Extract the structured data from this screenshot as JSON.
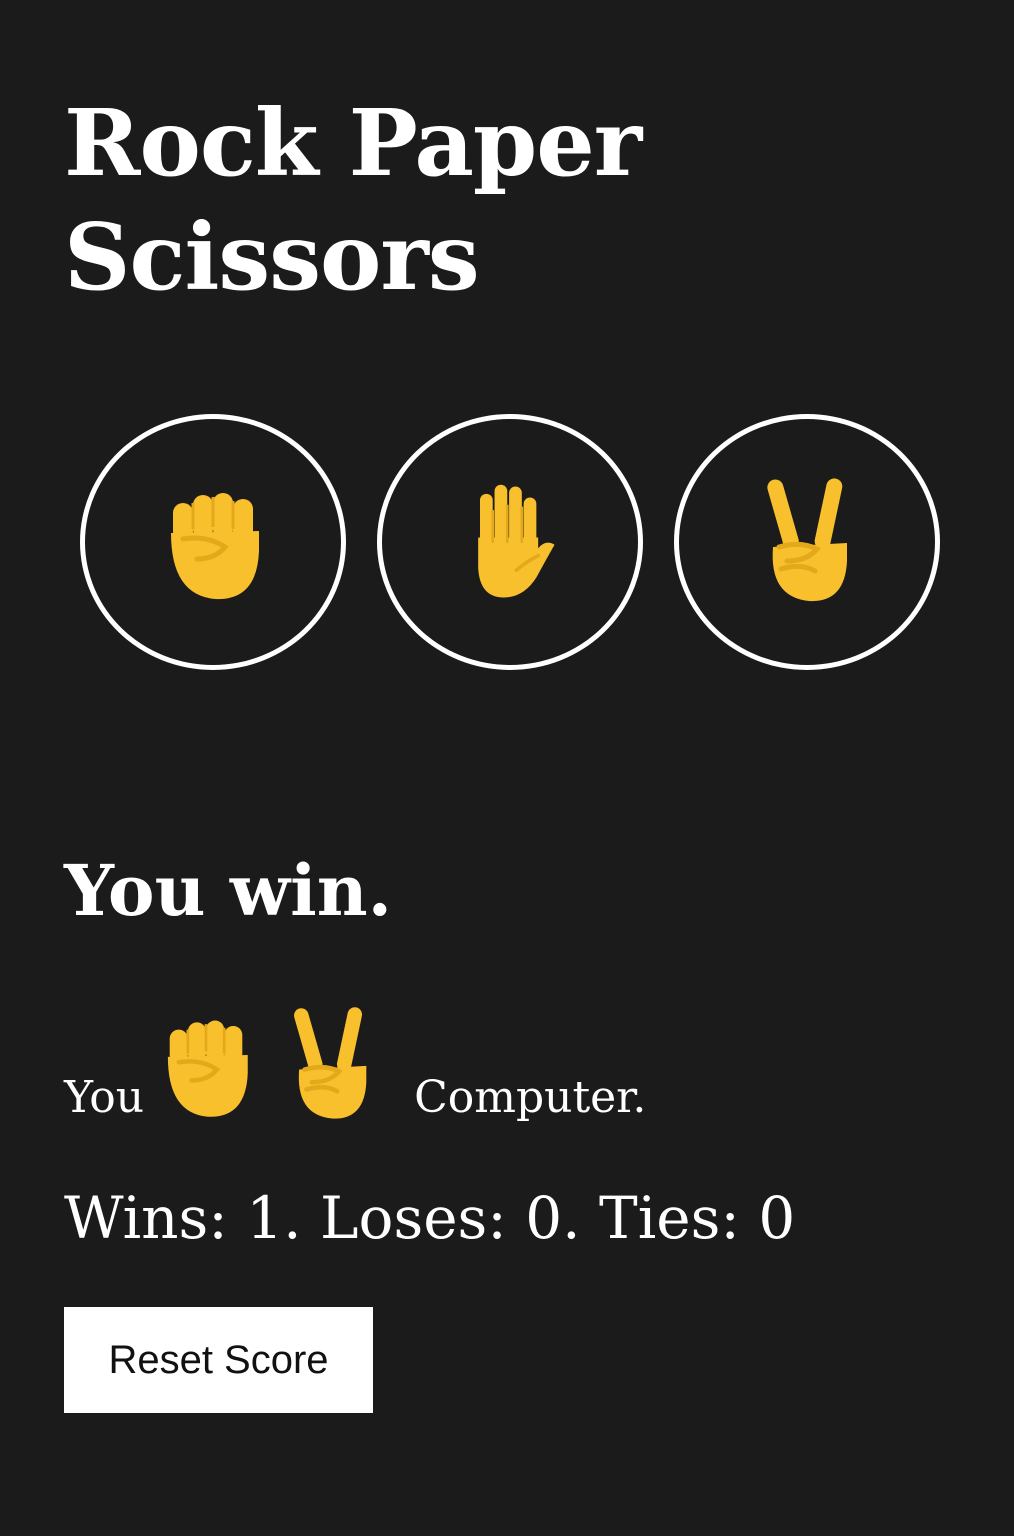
{
  "app": {
    "title": "Rock Paper Scissors"
  },
  "choices": [
    {
      "name": "rock",
      "icon": "raised-fist-icon"
    },
    {
      "name": "paper",
      "icon": "raised-hand-icon"
    },
    {
      "name": "scissors",
      "icon": "victory-hand-icon"
    }
  ],
  "result": {
    "message": "You win.",
    "you_label": "You",
    "player_move_icon": "raised-fist-icon",
    "computer_move_icon": "victory-hand-icon",
    "computer_label": "Computer."
  },
  "score": {
    "text": "Wins: 1. Loses: 0. Ties: 0",
    "wins": 1,
    "loses": 0,
    "ties": 0
  },
  "reset_button": {
    "label": "Reset Score"
  },
  "colors": {
    "background": "#1b1b1b",
    "text": "#ffffff",
    "emoji_fill": "#f7c02c",
    "emoji_shade": "#e4a91a",
    "button_bg": "#ffffff",
    "button_text": "#111111"
  }
}
